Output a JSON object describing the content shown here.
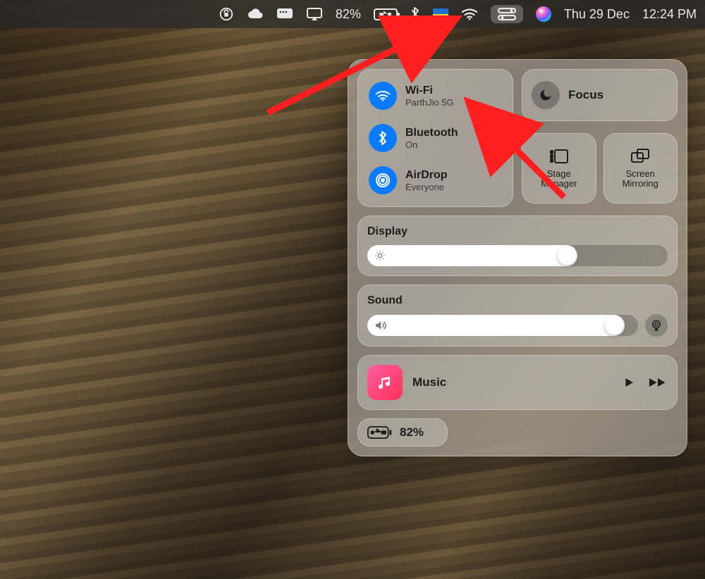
{
  "menubar": {
    "battery_percent": "82%",
    "date": "Thu 29 Dec",
    "time": "12:24 PM"
  },
  "control_center": {
    "wifi": {
      "label": "Wi-Fi",
      "status": "ParthJio 5G"
    },
    "bluetooth": {
      "label": "Bluetooth",
      "status": "On"
    },
    "airdrop": {
      "label": "AirDrop",
      "status": "Everyone"
    },
    "focus": {
      "label": "Focus"
    },
    "stage_manager": {
      "label": "Stage Manager"
    },
    "screen_mirroring": {
      "label": "Screen Mirroring"
    },
    "display": {
      "label": "Display",
      "value_percent": 70
    },
    "sound": {
      "label": "Sound",
      "value_percent": 95
    },
    "now_playing": {
      "app": "Music"
    },
    "battery": {
      "percent": "82%"
    }
  }
}
